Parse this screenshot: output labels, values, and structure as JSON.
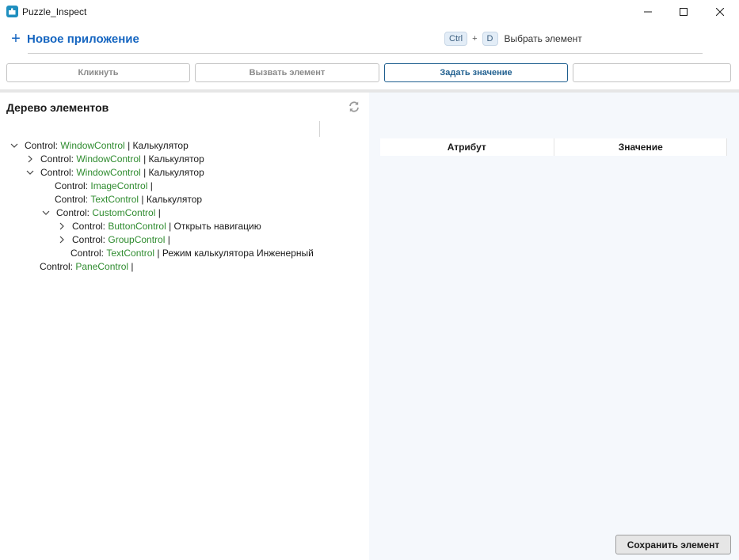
{
  "window": {
    "title": "Puzzle_Inspect",
    "icon": "puzzle-app-icon"
  },
  "header": {
    "new_app_label": "Новое приложение",
    "hotkey": {
      "key1": "Ctrl",
      "plus": "+",
      "key2": "D",
      "label": "Выбрать элемент"
    }
  },
  "actions": {
    "click_label": "Кликнуть",
    "invoke_label": "Вызвать элемент",
    "set_value_label": "Задать значение",
    "extra_label": ""
  },
  "tree_panel": {
    "title": "Дерево элементов",
    "rows": [
      {
        "prefix": "Control: ",
        "type": "WindowControl",
        "sep": " | ",
        "name": "Калькулятор",
        "chevron": "down"
      },
      {
        "prefix": "Control: ",
        "type": "WindowControl",
        "sep": " | ",
        "name": "Калькулятор",
        "chevron": "right"
      },
      {
        "prefix": "Control: ",
        "type": "WindowControl",
        "sep": " | ",
        "name": "Калькулятор",
        "chevron": "down"
      },
      {
        "prefix": "Control: ",
        "type": "ImageControl",
        "sep": " |",
        "name": "",
        "chevron": "none"
      },
      {
        "prefix": "Control: ",
        "type": "TextControl",
        "sep": " | ",
        "name": "Калькулятор",
        "chevron": "none"
      },
      {
        "prefix": "Control: ",
        "type": "CustomControl",
        "sep": " |",
        "name": "",
        "chevron": "down"
      },
      {
        "prefix": "Control: ",
        "type": "ButtonControl",
        "sep": " | ",
        "name": "Открыть навигацию",
        "chevron": "right"
      },
      {
        "prefix": "Control: ",
        "type": "GroupControl",
        "sep": " |",
        "name": "",
        "chevron": "right"
      },
      {
        "prefix": "Control: ",
        "type": "TextControl",
        "sep": " | ",
        "name": "Режим калькулятора Инженерный",
        "chevron": "none"
      },
      {
        "prefix": "Control: ",
        "type": "PaneControl",
        "sep": " |",
        "name": "",
        "chevron": "none"
      }
    ]
  },
  "attributes_panel": {
    "col_attribute": "Атрибут",
    "col_value": "Значение",
    "save_label": "Сохранить элемент"
  },
  "colors": {
    "accent": "#1565c0",
    "type_text": "#2e8b2e",
    "right_panel_bg": "#f5f8fc"
  }
}
